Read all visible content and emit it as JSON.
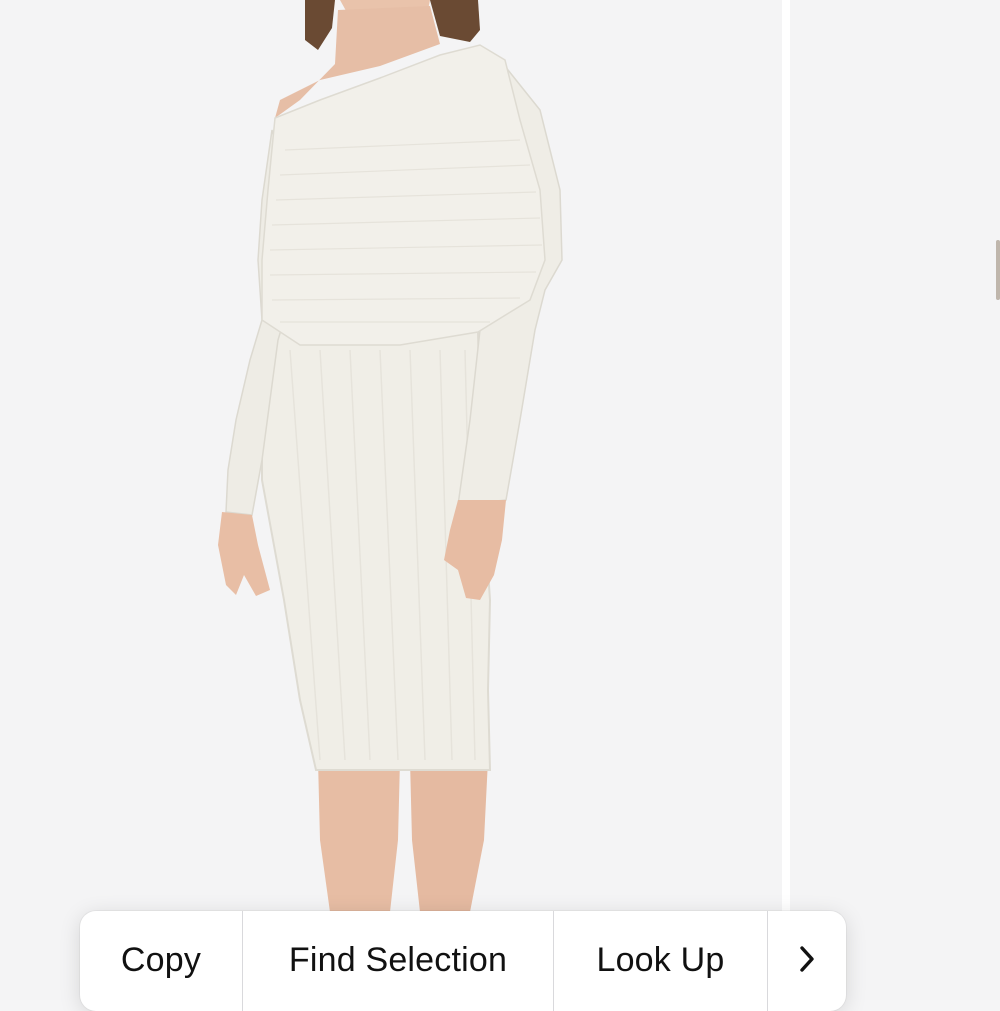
{
  "edit_menu": {
    "items": [
      {
        "label": "Copy"
      },
      {
        "label": "Find Selection"
      },
      {
        "label": "Look Up"
      }
    ],
    "more_icon": "chevron-right-icon"
  },
  "colors": {
    "background": "#f4f4f5",
    "garment": "#f1efe8",
    "skin": "#e9c3ab",
    "hair": "#6a4a33",
    "menu_background": "#ffffff",
    "menu_text": "#111111",
    "menu_divider": "#d9d9dc"
  }
}
